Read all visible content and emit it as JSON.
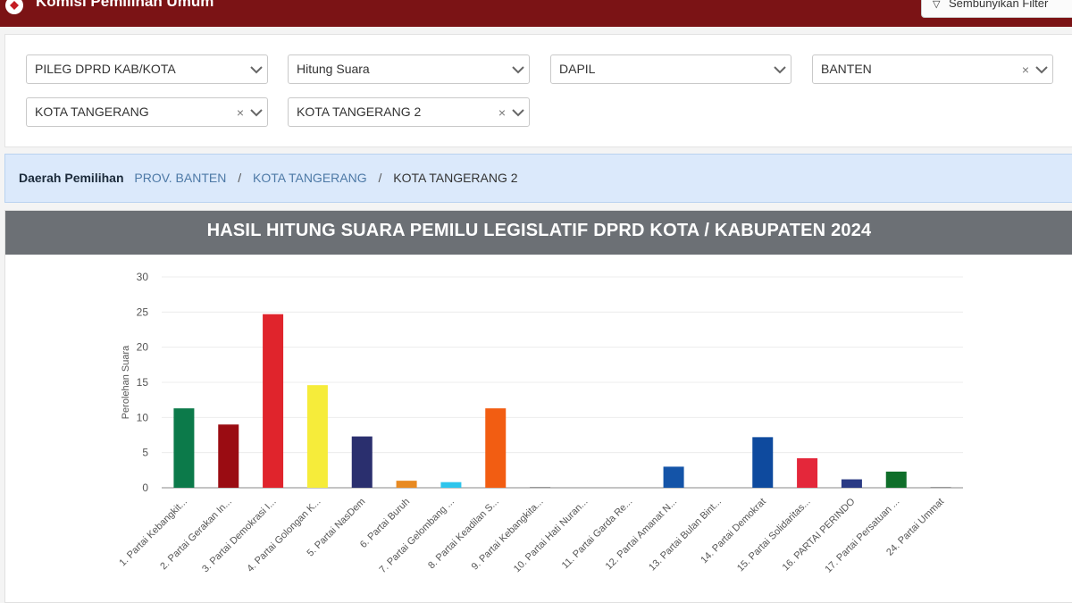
{
  "header": {
    "brand": "Komisi Pemilihan Umum",
    "filter_button": "Sembunyikan Filter",
    "colors": {
      "bar": "#7b1315"
    }
  },
  "filters": {
    "election": "PILEG DPRD KAB/KOTA",
    "mode": "Hitung Suara",
    "level": "DAPIL",
    "province": "BANTEN",
    "city": "KOTA TANGERANG",
    "dapil": "KOTA TANGERANG 2"
  },
  "breadcrumb": {
    "label": "Daerah Pemilihan",
    "items": [
      "PROV. BANTEN",
      "KOTA TANGERANG",
      "KOTA TANGERANG 2"
    ],
    "separator": "/"
  },
  "chart_panel": {
    "title": "HASIL HITUNG SUARA PEMILU LEGISLATIF DPRD KOTA / KABUPATEN 2024"
  },
  "chart_data": {
    "type": "bar",
    "ylabel": "Perolehan Suara",
    "xlabel": "",
    "ylim": [
      0,
      30
    ],
    "yticks": [
      0,
      5,
      10,
      15,
      20,
      25,
      30
    ],
    "grid": true,
    "legend": "none",
    "categories": [
      "1. Partai Kebangkit...",
      "2. Partai Gerakan In...",
      "3. Partai Demokrasi I...",
      "4. Partai Golongan K...",
      "5. Partai NasDem",
      "6. Partai Buruh",
      "7. Partai Gelombang ...",
      "8. Partai Keadilan S...",
      "9. Partai Kebangkita...",
      "10. Partai Hati Nuran...",
      "11. Partai Garda Re...",
      "12. Partai Amanat N...",
      "13. Partai Bulan Bint...",
      "14. Partai Demokrat",
      "15. Partai Solidaritas...",
      "16. PARTAI PERINDO",
      "17. Partai Persatuan ...",
      "24. Partai Ummat"
    ],
    "values": [
      11.3,
      9,
      24.7,
      14.6,
      7.3,
      1,
      0.8,
      11.3,
      0.1,
      0,
      0,
      3,
      0,
      7.2,
      4.2,
      1.2,
      2.3,
      0.1
    ],
    "colors": [
      "#0c7a4a",
      "#9a0c12",
      "#e0242c",
      "#f6ec3a",
      "#2a2f6e",
      "#e88a22",
      "#2ec5ec",
      "#f25d12",
      "#999999",
      "#999999",
      "#999999",
      "#1454a8",
      "#999999",
      "#0e4a9e",
      "#e4273a",
      "#2a3a84",
      "#0f6e2a",
      "#999999"
    ]
  }
}
